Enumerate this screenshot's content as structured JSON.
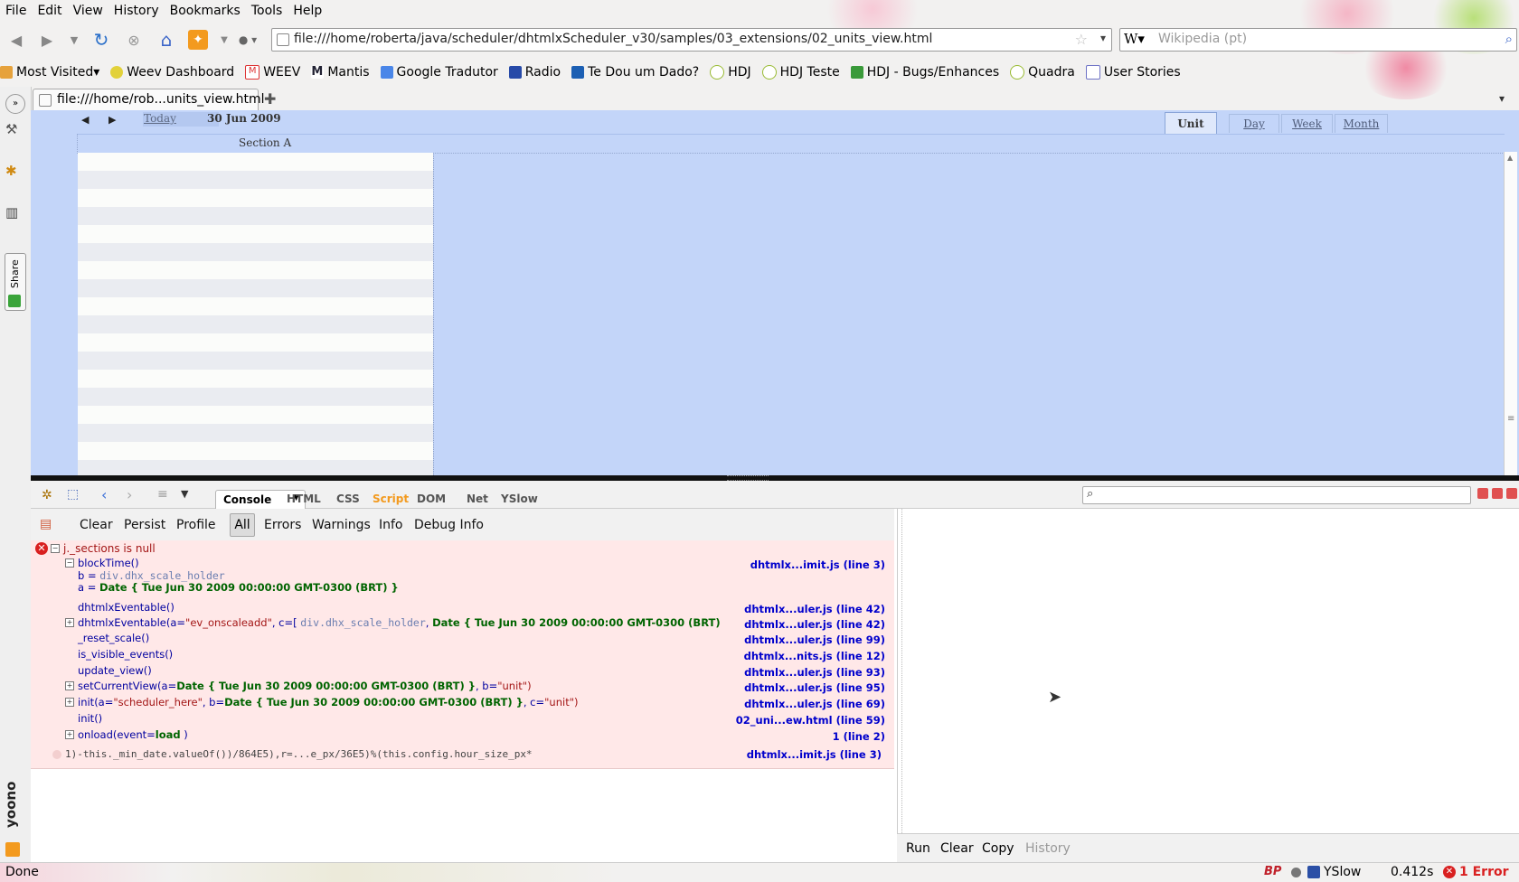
{
  "menu": [
    "File",
    "Edit",
    "View",
    "History",
    "Bookmarks",
    "Tools",
    "Help"
  ],
  "url": "file:///home/roberta/java/scheduler/dhtmlxScheduler_v30/samples/03_extensions/02_units_view.html",
  "search_placeholder": "Wikipedia (pt)",
  "bookmarks": [
    "Most Visited",
    "Weev Dashboard",
    "WEEV",
    "Mantis",
    "Google Tradutor",
    "Radio",
    "Te Dou um Dado?",
    "HDJ",
    "HDJ Teste",
    "HDJ - Bugs/Enhances",
    "Quadra",
    "User Stories"
  ],
  "tab_title": "file:///home/rob...units_view.html",
  "sidebar_share": "Share",
  "sidebar_yoono": "yoono",
  "scheduler": {
    "today": "Today",
    "date": "30 Jun 2009",
    "section": "Section A",
    "views": {
      "unit": "Unit",
      "day": "Day",
      "week": "Week",
      "month": "Month"
    }
  },
  "firebug": {
    "panels": [
      "Console",
      "HTML",
      "CSS",
      "Script",
      "DOM",
      "Net",
      "YSlow"
    ],
    "console_buttons": [
      "Clear",
      "Persist",
      "Profile"
    ],
    "filters": [
      "All",
      "Errors",
      "Warnings",
      "Info",
      "Debug Info"
    ],
    "error_title": "j._sections is null",
    "stack": [
      {
        "fn": "blockTime()",
        "src": "dhtmlx...imit.js (line 3)"
      },
      {
        "b": "b = ",
        "b_val": "div.dhx_scale_holder",
        "a": "a = ",
        "a_val": "Date { Tue Jun 30 2009 00:00:00 GMT-0300 (BRT) }"
      },
      {
        "fn": "dhtmlxEventable()",
        "src": "dhtmlx...uler.js (line 42)"
      },
      {
        "fn": "dhtmlxEventable(a=",
        "arg1": "\"ev_onscaleadd\"",
        "sep1": ",  c=[ ",
        "arg2": "div.dhx_scale_holder",
        "sep2": ",  ",
        "arg3": "Date { Tue Jun 30 2009 00:00:00 GMT-0300 (BRT)",
        "src": "dhtmlx...uler.js (line 42)"
      },
      {
        "fn": "_reset_scale()",
        "src": "dhtmlx...uler.js (line 99)"
      },
      {
        "fn": "is_visible_events()",
        "src": "dhtmlx...nits.js (line 12)"
      },
      {
        "fn": "update_view()",
        "src": "dhtmlx...uler.js (line 93)"
      },
      {
        "fn": "setCurrentView(a=",
        "arg1": "Date { Tue Jun 30 2009 00:00:00 GMT-0300 (BRT) }",
        "sep": ",  b=",
        "arg2": "\"unit\")",
        "src": "dhtmlx...uler.js (line 95)"
      },
      {
        "fn": "init(a=",
        "arg1": "\"scheduler_here\"",
        "sep": ",  b=",
        "arg2": "Date { Tue Jun 30 2009 00:00:00 GMT-0300 (BRT) }",
        "sep2": ",  c=",
        "arg3": "\"unit\")",
        "src": "dhtmlx...uler.js (line 69)"
      },
      {
        "fn": "init()",
        "src": "02_uni...ew.html (line 59)"
      },
      {
        "fn": "onload(event=",
        "arg1": "load",
        "end": " )",
        "src": "1 (line 2)"
      }
    ],
    "source_line": "1)-this._min_date.valueOf())/864E5),r=...e_px/36E5)%(this.config.hour_size_px*",
    "source_line_src": "dhtmlx...imit.js (line 3)",
    "cmd_buttons": [
      "Run",
      "Clear",
      "Copy",
      "History"
    ]
  },
  "status": {
    "left": "Done",
    "yslow": "YSlow",
    "time": "0.412s",
    "errors": "1 Error"
  }
}
